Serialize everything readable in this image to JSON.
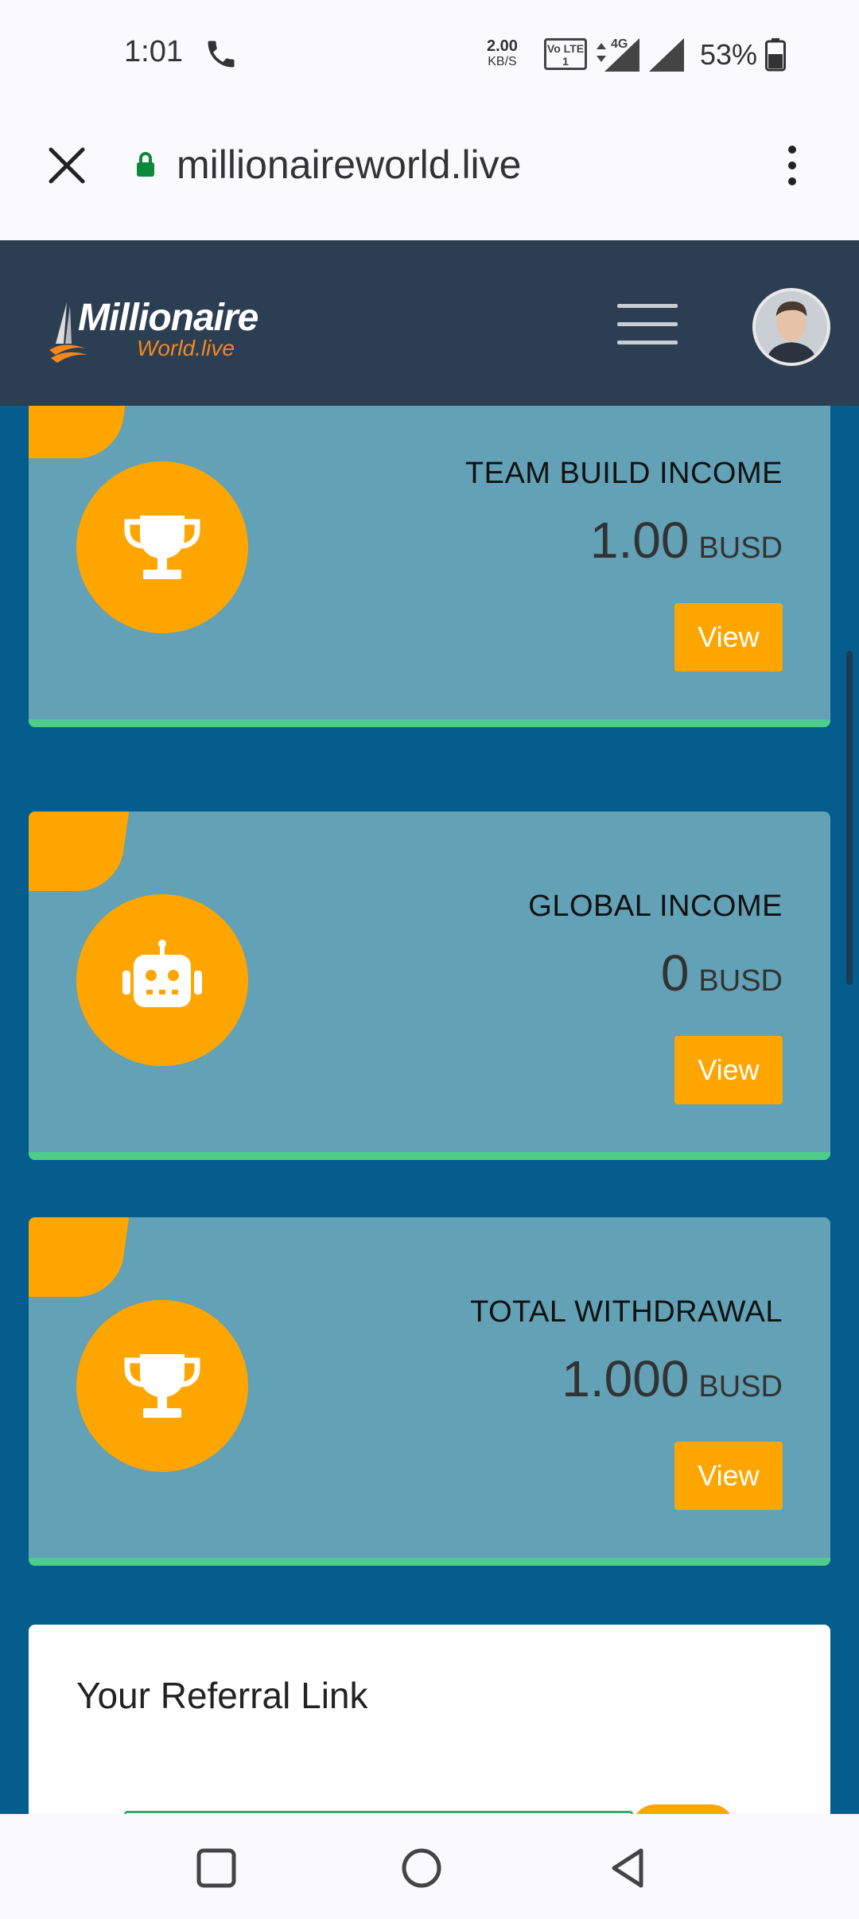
{
  "status_bar": {
    "time": "1:01",
    "net_speed_value": "2.00",
    "net_speed_unit": "KB/S",
    "volte_label": "Vo LTE 1",
    "network_type": "4G",
    "battery_percent": "53%"
  },
  "browser": {
    "url": "millionaireworld.live"
  },
  "header": {
    "logo_main": "Millionaire",
    "logo_sub": "World.live"
  },
  "cards": [
    {
      "title": "TEAM BUILD INCOME",
      "amount": "1.00",
      "currency": "BUSD",
      "button": "View",
      "icon": "trophy-icon"
    },
    {
      "title": "GLOBAL INCOME",
      "amount": "0",
      "currency": "BUSD",
      "button": "View",
      "icon": "robot-icon"
    },
    {
      "title": "TOTAL WITHDRAWAL",
      "amount": "1.000",
      "currency": "BUSD",
      "button": "View",
      "icon": "trophy-icon"
    }
  ],
  "referral": {
    "title": "Your Referral Link"
  },
  "colors": {
    "header_bg": "#2c3e52",
    "main_bg": "#045d8c",
    "card_bg": "#62a1b6",
    "accent_orange": "#ffa500",
    "accent_green": "#4dcc8a"
  }
}
